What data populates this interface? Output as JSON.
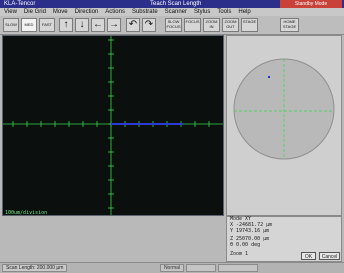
{
  "window": {
    "app_title": "KLA-Tencor",
    "title": "Teach Scan Length",
    "status_chip": "Standby Mode"
  },
  "menu": [
    "View",
    "Die Grid",
    "Move",
    "Direction",
    "Actions",
    "Substrate",
    "Scanner",
    "Stylus",
    "Tools",
    "Help"
  ],
  "toolbar": {
    "mode_buttons": [
      "SLOW",
      "MED",
      "FAST"
    ],
    "active_mode": "MED",
    "arrows": [
      "↑",
      "↓",
      "←",
      "→"
    ],
    "rotate": [
      "↶",
      "↷"
    ],
    "function_buttons": [
      "SLOW FOCUS",
      "FOCUS",
      "ZOOM IN",
      "ZOOM OUT",
      "STAGE",
      "HOME STAGE"
    ]
  },
  "scan_view": {
    "scale_label": "100um/division"
  },
  "info": {
    "mode": "Mode  XY",
    "x": "X -24681.72 µm",
    "y": "Y 19743.16 µm",
    "z": "Z  25070.00 µm",
    "theta": "θ     0.00 deg",
    "zoom": "Zoom       1",
    "ok": "OK",
    "cancel": "Cancel"
  },
  "statusbar": {
    "scan_length": "Scan Length: 200.000 µm",
    "field_2": "Normal"
  },
  "colors": {
    "crosshair": "#38d84e",
    "scan_line": "#2b3bd6",
    "wafer": "#b9b9b9",
    "wafer_mark": "#2635c9"
  }
}
